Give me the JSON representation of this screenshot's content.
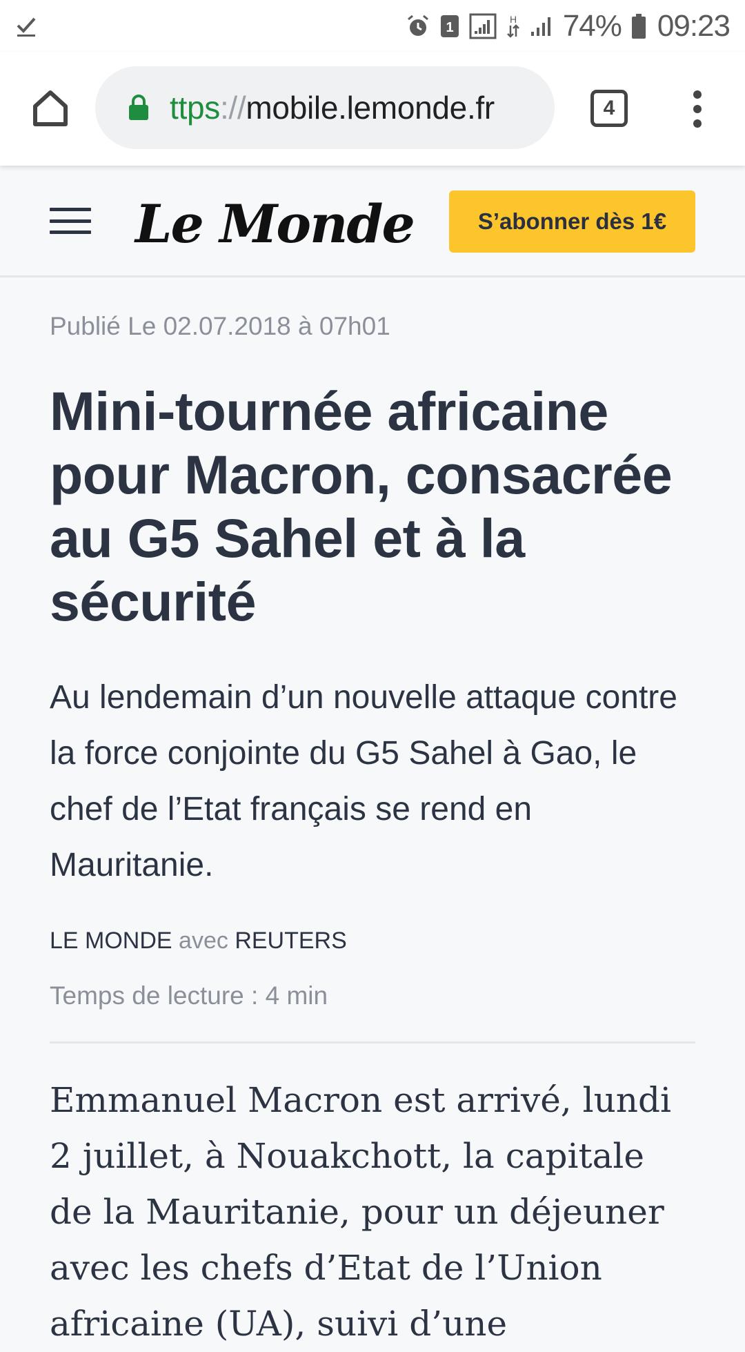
{
  "status_bar": {
    "battery": "74%",
    "time": "09:23",
    "sim_slot": "1"
  },
  "browser": {
    "url_scheme": "ttps",
    "url_separator": "://",
    "url_host": "mobile.lemonde.fr",
    "tab_count": "4"
  },
  "site_header": {
    "logo": "Le Monde",
    "subscribe_label": "S’abonner dès 1€",
    "subscribe_color": "#fdc52c"
  },
  "article": {
    "published": "Publié Le 02.07.2018 à 07h01",
    "headline": "Mini-tournée africaine pour Macron, consacrée au G5 Sahel et à la sécurité",
    "lead": "Au lendemain d’un nouvelle attaque contre la force conjointe du G5 Sahel à Gao, le chef de l’Etat français se rend en Mauritanie.",
    "byline_author": "LE MONDE",
    "byline_with": "avec",
    "byline_source": "REUTERS",
    "reading_time": "Temps de lecture : 4 min",
    "body": "Emmanuel Macron est arrivé, lundi 2 juillet, à Nouakchott, la capitale de la Mauritanie, pour un déjeuner avec les chefs d’Etat de l’Union africaine (UA), suivi d’une"
  }
}
